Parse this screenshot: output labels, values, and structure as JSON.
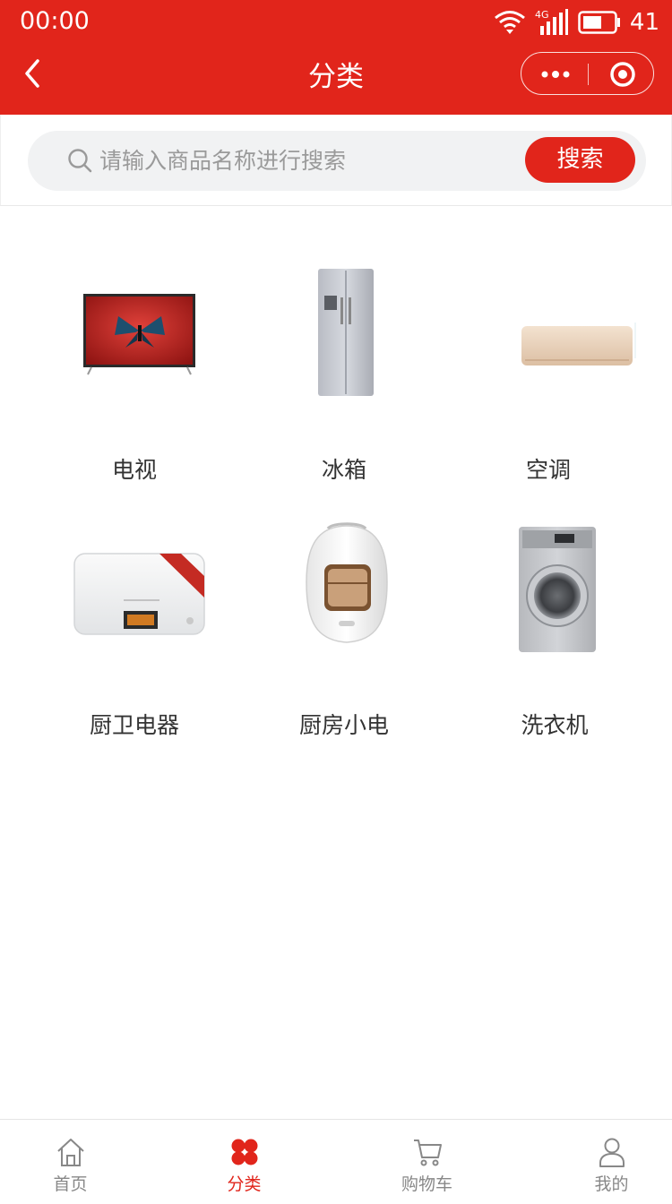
{
  "status_bar": {
    "time": "00:00",
    "network": "4G",
    "battery": "41"
  },
  "nav": {
    "title": "分类"
  },
  "search": {
    "placeholder": "请输入商品名称进行搜索",
    "value": "",
    "button_label": "搜索"
  },
  "categories": [
    {
      "label": "电视",
      "icon": "tv-image"
    },
    {
      "label": "冰箱",
      "icon": "refrigerator-image"
    },
    {
      "label": "空调",
      "icon": "air-conditioner-image"
    },
    {
      "label": "厨卫电器",
      "icon": "water-heater-image"
    },
    {
      "label": "厨房小电",
      "icon": "rice-cooker-image"
    },
    {
      "label": "洗衣机",
      "icon": "washing-machine-image"
    }
  ],
  "tabbar": {
    "items": [
      {
        "label": "首页",
        "icon": "home-icon",
        "active": false
      },
      {
        "label": "分类",
        "icon": "category-icon",
        "active": true
      },
      {
        "label": "购物车",
        "icon": "cart-icon",
        "active": false
      },
      {
        "label": "我的",
        "icon": "user-icon",
        "active": false
      }
    ]
  },
  "colors": {
    "brand": "#e1251b",
    "text": "#333333",
    "muted": "#888888",
    "search_bg": "#f1f2f3"
  }
}
